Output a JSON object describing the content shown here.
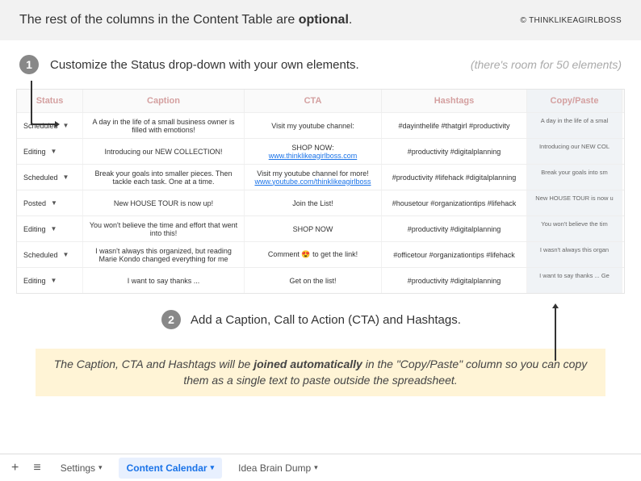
{
  "header": {
    "text_pre": "The rest of the columns in the Content Table are ",
    "text_bold": "optional",
    "text_post": ".",
    "copyright": "© THINKLIKEAGIRLBOSS"
  },
  "step1": {
    "num": "1",
    "text": "Customize the Status drop-down with your own elements.",
    "hint": "(there's room for 50 elements)"
  },
  "table": {
    "headers": {
      "status": "Status",
      "caption": "Caption",
      "cta": "CTA",
      "hashtags": "Hashtags",
      "copy": "Copy/Paste"
    },
    "rows": [
      {
        "status": "Scheduled",
        "caption": "A day in the life of a small business owner is filled with emotions!",
        "cta": "Visit my youtube channel:",
        "link": "",
        "hashtags": "#dayinthelife #thatgirl #productivity",
        "copy": "A day in the life of a smal"
      },
      {
        "status": "Editing",
        "caption": "Introducing our NEW COLLECTION!",
        "cta": "SHOP NOW:",
        "link": "www.thinklikeagirlboss.com",
        "hashtags": "#productivity #digitalplanning",
        "copy": "Introducing our NEW COL"
      },
      {
        "status": "Scheduled",
        "caption": "Break your goals into smaller pieces. Then tackle each task. One at a time.",
        "cta": "Visit my youtube channel for more!",
        "link": "www.youtube.com/thinklikeagirlboss",
        "hashtags": "#productivity #lifehack #digitalplanning",
        "copy": "Break your goals into sm"
      },
      {
        "status": "Posted",
        "caption": "New HOUSE TOUR is now up!",
        "cta": "Join the List!",
        "link": "",
        "hashtags": "#housetour #organizationtips #lifehack",
        "copy": "New HOUSE TOUR is now u"
      },
      {
        "status": "Editing",
        "caption": "You won't believe the time and effort that went into this!",
        "cta": "SHOP NOW",
        "link": "",
        "hashtags": "#productivity #digitalplanning",
        "copy": "You won't believe the tim"
      },
      {
        "status": "Scheduled",
        "caption": "I wasn't always this organized, but reading Marie Kondo changed everything for me",
        "cta": "Comment 😍  to get the link!",
        "link": "",
        "hashtags": "#officetour #organizationtips #lifehack",
        "copy": "I wasn't always this organ"
      },
      {
        "status": "Editing",
        "caption": "I want to say thanks ...",
        "cta": "Get on the list!",
        "link": "",
        "hashtags": "#productivity #digitalplanning",
        "copy": "I want to say thanks ...  Ge"
      }
    ]
  },
  "step2": {
    "num": "2",
    "text": "Add a Caption, Call to Action (CTA) and Hashtags."
  },
  "highlight": {
    "pre": "The Caption, CTA and Hashtags will be ",
    "bold": "joined automatically",
    "post": " in the \"Copy/Paste\" column so you can copy them as a single text to paste outside the spreadsheet."
  },
  "footer": {
    "plus": "+",
    "menu": "≡",
    "tab1": "Settings",
    "tab2": "Content Calendar",
    "tab3": "Idea Brain Dump",
    "caret": "▾"
  }
}
